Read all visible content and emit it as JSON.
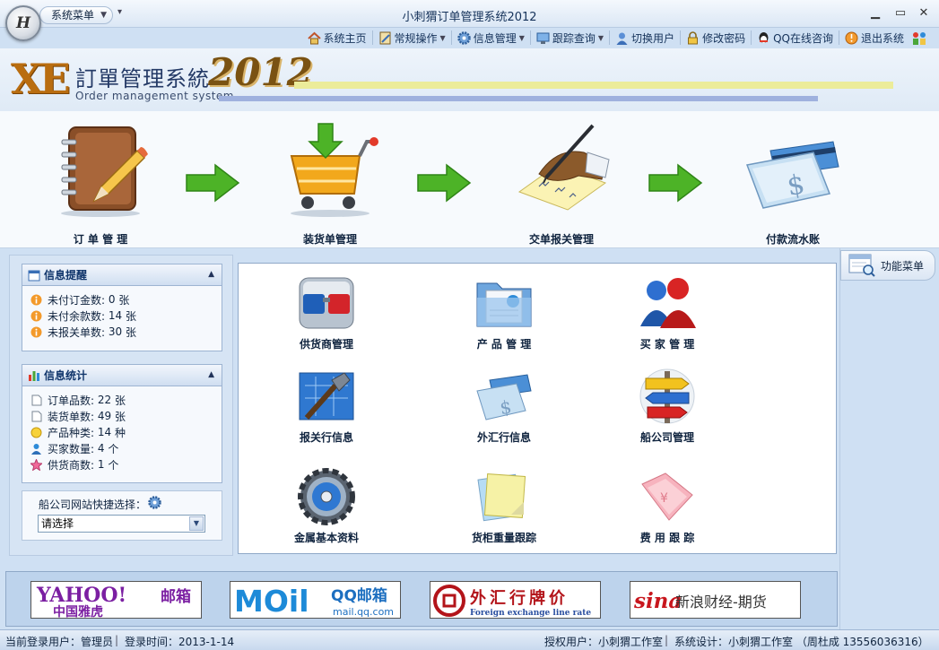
{
  "window": {
    "title": "小刺猬订单管理系统2012",
    "orb_letter": "H",
    "system_menu": "系统菜单",
    "controls": [
      "▁",
      "▭",
      "✕"
    ]
  },
  "toolbar": {
    "items": [
      {
        "label": "系统主页",
        "icon": "home-icon",
        "dropdown": false
      },
      {
        "label": "常规操作",
        "icon": "notebook-icon",
        "dropdown": true
      },
      {
        "label": "信息管理",
        "icon": "gear-icon",
        "dropdown": true
      },
      {
        "label": "跟踪查询",
        "icon": "monitor-icon",
        "dropdown": true
      },
      {
        "label": "切换用户",
        "icon": "user-icon",
        "dropdown": false
      },
      {
        "label": "修改密码",
        "icon": "lock-icon",
        "dropdown": false
      },
      {
        "label": "QQ在线咨询",
        "icon": "qq-icon",
        "dropdown": false
      },
      {
        "label": "退出系统",
        "icon": "exit-icon",
        "dropdown": false
      }
    ]
  },
  "banner": {
    "logo_mark": "XE",
    "title_cn": "訂單管理系統",
    "title_en": "Order management system",
    "year": "2012"
  },
  "workflow": [
    {
      "label": "订 单 管 理",
      "icon": "notebook-pencil-icon"
    },
    {
      "label": "装货单管理",
      "icon": "shopping-cart-icon"
    },
    {
      "label": "交单报关管理",
      "icon": "signing-hand-icon"
    },
    {
      "label": "付款流水账",
      "icon": "payment-check-icon"
    }
  ],
  "info_reminder": {
    "title": "信息提醒",
    "items": [
      {
        "label": "未付订金数:",
        "value": "0",
        "unit": "张"
      },
      {
        "label": "未付余款数:",
        "value": "14",
        "unit": "张"
      },
      {
        "label": "未报关单数:",
        "value": "30",
        "unit": "张"
      }
    ]
  },
  "info_stats": {
    "title": "信息统计",
    "items": [
      {
        "label": "订单品数:",
        "value": "22",
        "unit": "张",
        "icon": "document-icon"
      },
      {
        "label": "装货单数:",
        "value": "49",
        "unit": "张",
        "icon": "document-icon"
      },
      {
        "label": "产品种类:",
        "value": "14",
        "unit": "种",
        "icon": "sun-icon"
      },
      {
        "label": "买家数量:",
        "value": "4",
        "unit": "个",
        "icon": "person-icon"
      },
      {
        "label": "供货商数:",
        "value": "1",
        "unit": "个",
        "icon": "star-icon"
      }
    ]
  },
  "shipping_site": {
    "label": "船公司网站快捷选择：",
    "selected": "请选择"
  },
  "modules": [
    {
      "label": "供货商管理",
      "icon": "glasses-icon"
    },
    {
      "label": "产 品 管 理",
      "icon": "folder-icon"
    },
    {
      "label": "买 家 管 理",
      "icon": "users-icon"
    },
    {
      "label": "报关行信息",
      "icon": "blueprint-tools-icon"
    },
    {
      "label": "外汇行信息",
      "icon": "exchange-check-icon"
    },
    {
      "label": "船公司管理",
      "icon": "signpost-icon"
    },
    {
      "label": "金属基本资料",
      "icon": "disc-gear-icon"
    },
    {
      "label": "货柜重量跟踪",
      "icon": "notes-icon"
    },
    {
      "label": "费 用 跟 踪",
      "icon": "pink-folder-icon"
    }
  ],
  "side": {
    "function_menu": "功能菜单"
  },
  "ads": [
    {
      "main": "YAHOO!",
      "tail": "邮箱",
      "sub": "中国雅虎"
    },
    {
      "main": "MOil",
      "tail": "QQ邮箱",
      "sub": "mail.qq.com"
    },
    {
      "main": "外汇行牌价",
      "sub": "Foreign exchange line rate"
    },
    {
      "main": "sina",
      "tail": "新浪财经-期货"
    }
  ],
  "status": {
    "user": "当前登录用户：管理员",
    "login_time": "登录时间：2013-1-14",
    "licensed": "授权用户：小刺猬工作室",
    "design": "系统设计：小刺猬工作室 （周杜成 13556036316）"
  },
  "colors": {
    "accent": "#15325a",
    "panel": "#cfe0f3",
    "arrow_green": "#4db327"
  }
}
